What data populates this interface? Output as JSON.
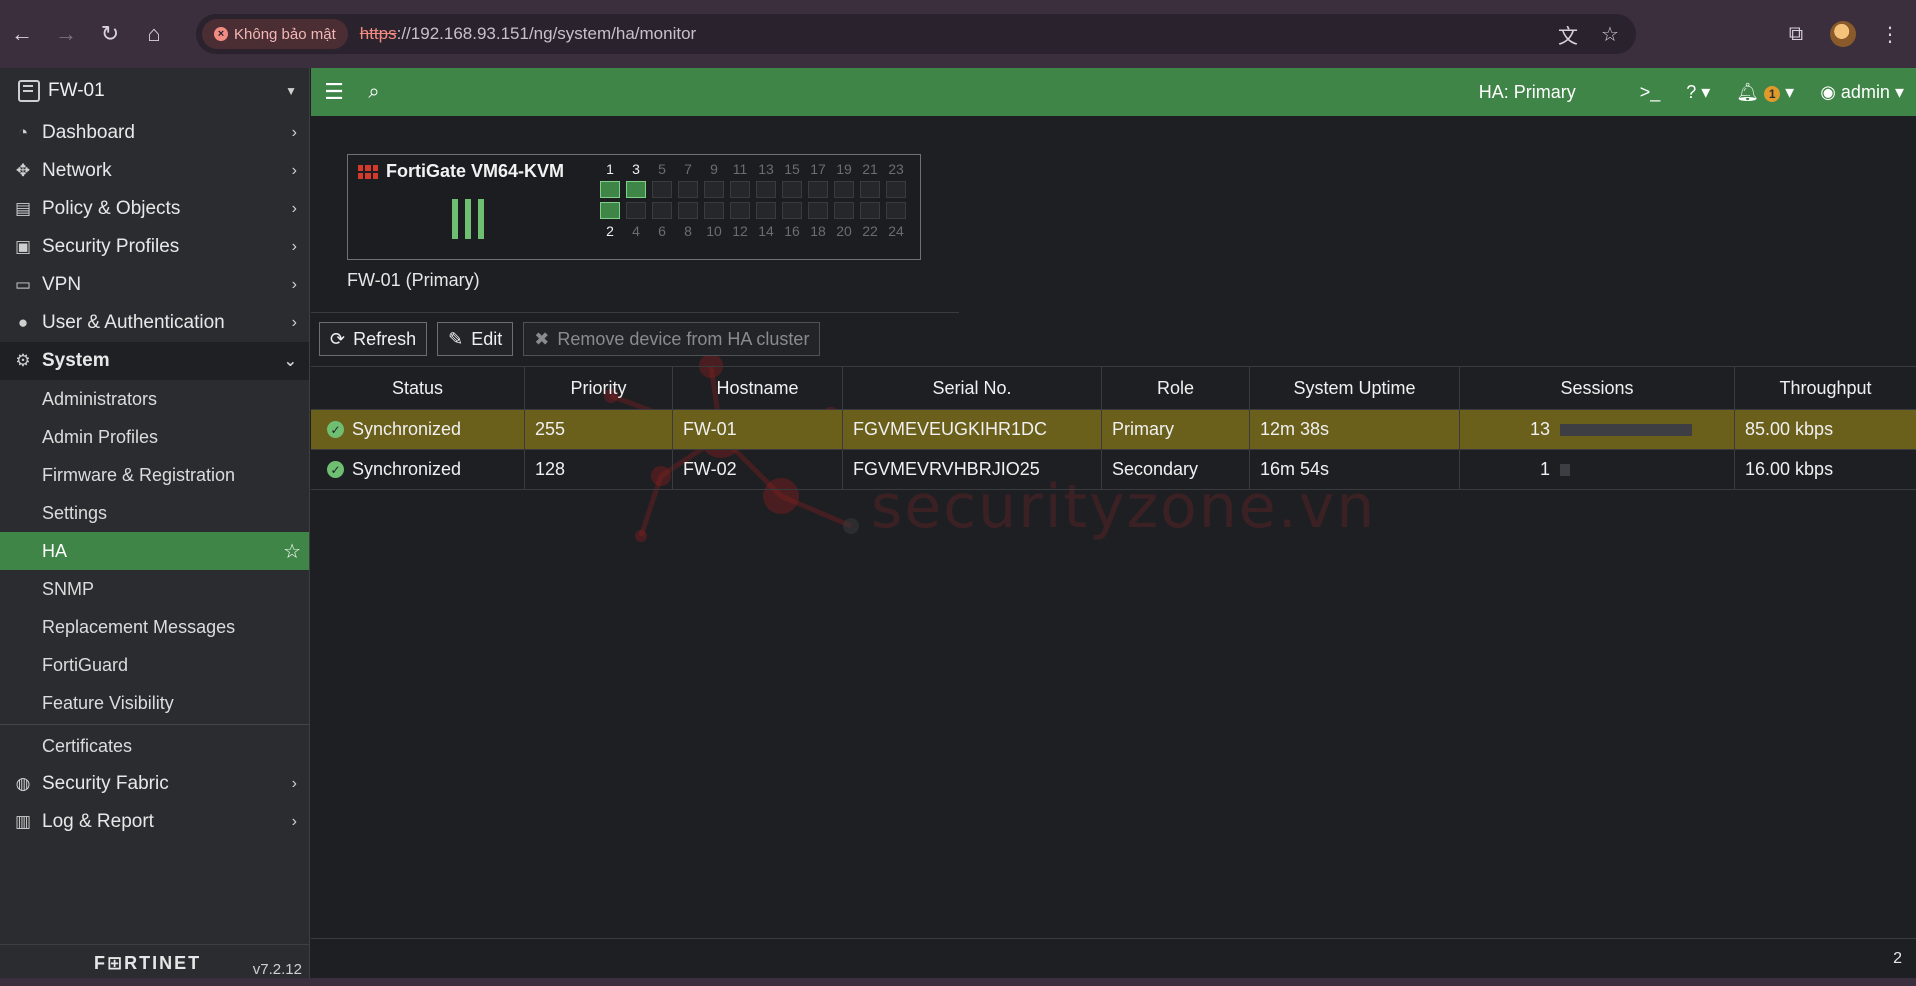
{
  "browser": {
    "security_chip": "Không bảo mật",
    "url_proto": "https",
    "url_rest": "://192.168.93.151/ng/system/ha/monitor"
  },
  "sidebar": {
    "device": "FW-01",
    "items": [
      {
        "label": "Dashboard",
        "icon": "dashboard-icon"
      },
      {
        "label": "Network",
        "icon": "network-icon"
      },
      {
        "label": "Policy & Objects",
        "icon": "policy-icon"
      },
      {
        "label": "Security Profiles",
        "icon": "lock-icon"
      },
      {
        "label": "VPN",
        "icon": "laptop-icon"
      },
      {
        "label": "User & Authentication",
        "icon": "user-icon"
      },
      {
        "label": "System",
        "icon": "gear-icon"
      }
    ],
    "system_sub": [
      "Administrators",
      "Admin Profiles",
      "Firmware & Registration",
      "Settings",
      "HA",
      "SNMP",
      "Replacement Messages",
      "FortiGuard",
      "Feature Visibility",
      "Certificates"
    ],
    "bottom_items": [
      {
        "label": "Security Fabric",
        "icon": "fabric-icon"
      },
      {
        "label": "Log & Report",
        "icon": "chart-icon"
      }
    ],
    "logo": "F⊞RTINET",
    "version": "v7.2.12"
  },
  "topbar": {
    "ha_label": "HA:  Primary",
    "notif_count": "1",
    "user": "admin"
  },
  "device": {
    "model": "FortiGate VM64-KVM",
    "caption": "FW-01 (Primary)",
    "top_ports": [
      "1",
      "3",
      "5",
      "7",
      "9",
      "11",
      "13",
      "15",
      "17",
      "19",
      "21",
      "23"
    ],
    "bottom_ports": [
      "2",
      "4",
      "6",
      "8",
      "10",
      "12",
      "14",
      "16",
      "18",
      "20",
      "22",
      "24"
    ]
  },
  "toolbar": {
    "refresh": "Refresh",
    "edit": "Edit",
    "remove": "Remove device from HA cluster"
  },
  "table": {
    "headers": [
      "Status",
      "Priority",
      "Hostname",
      "Serial No.",
      "Role",
      "System Uptime",
      "Sessions",
      "Throughput"
    ],
    "rows": [
      {
        "status": "Synchronized",
        "priority": "255",
        "hostname": "FW-01",
        "serial": "FGVMEVEUGKIHR1DC",
        "role": "Primary",
        "uptime": "12m 38s",
        "sessions": "13",
        "sessions_fraction": 1.0,
        "throughput": "85.00 kbps"
      },
      {
        "status": "Synchronized",
        "priority": "128",
        "hostname": "FW-02",
        "serial": "FGVMEVRVHBRJIO25",
        "role": "Secondary",
        "uptime": "16m 54s",
        "sessions": "1",
        "sessions_fraction": 0.077,
        "throughput": "16.00 kbps"
      }
    ]
  },
  "watermark": "securityzone.vn",
  "status_count": "2"
}
